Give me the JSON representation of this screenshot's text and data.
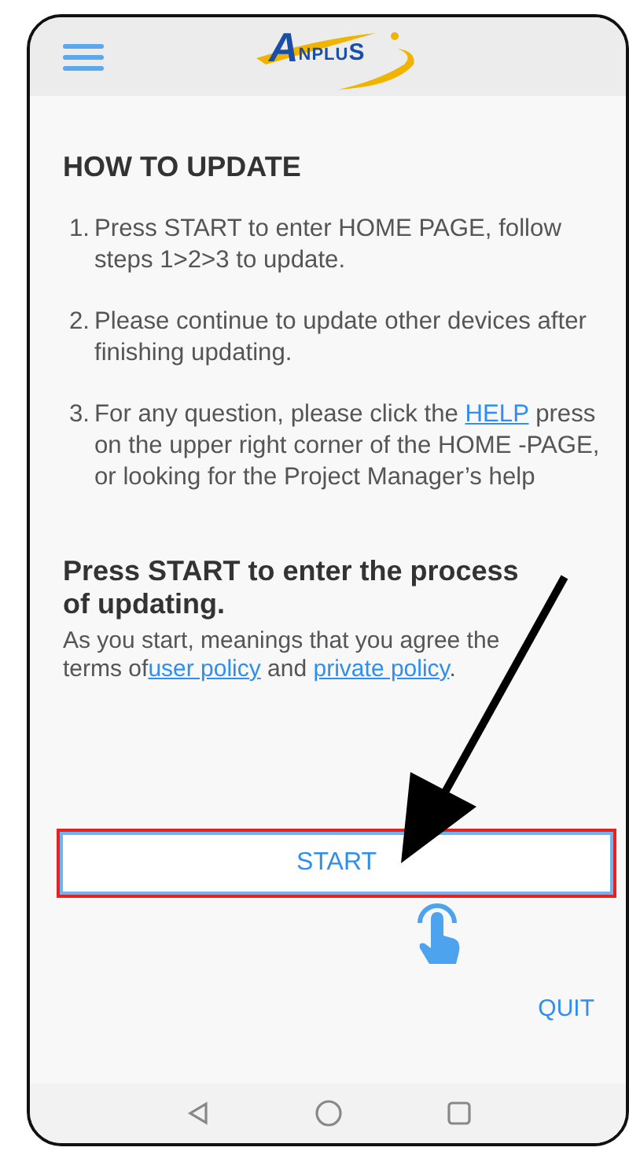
{
  "header": {
    "logo_initial": "A",
    "logo_rest": "NPLU",
    "logo_end": "S"
  },
  "title": "HOW TO UPDATE",
  "steps": [
    {
      "number": "1.",
      "parts": [
        {
          "kind": "text",
          "text": "Press START to enter HOME PAGE, follow steps 1>2>3 to update."
        }
      ]
    },
    {
      "number": "2.",
      "parts": [
        {
          "kind": "text",
          "text": "Please continue to update other devices after finishing updating."
        }
      ]
    },
    {
      "number": "3.",
      "parts": [
        {
          "kind": "text",
          "text": "For any question, please click the "
        },
        {
          "kind": "link",
          "text": "HELP"
        },
        {
          "kind": "text",
          "text": " press on the upper right corner of the HOME -PAGE, or looking for the Project Manager’s help"
        }
      ]
    }
  ],
  "prompt": "Press START to enter the process of updating.",
  "note": [
    {
      "kind": "text",
      "text": "As you start, meanings that you agree the terms of"
    },
    {
      "kind": "link",
      "text": "user policy"
    },
    {
      "kind": "text",
      "text": " and "
    },
    {
      "kind": "link",
      "text": "private policy"
    },
    {
      "kind": "text",
      "text": "."
    }
  ],
  "start_button": "START",
  "quit_button": "QUIT"
}
